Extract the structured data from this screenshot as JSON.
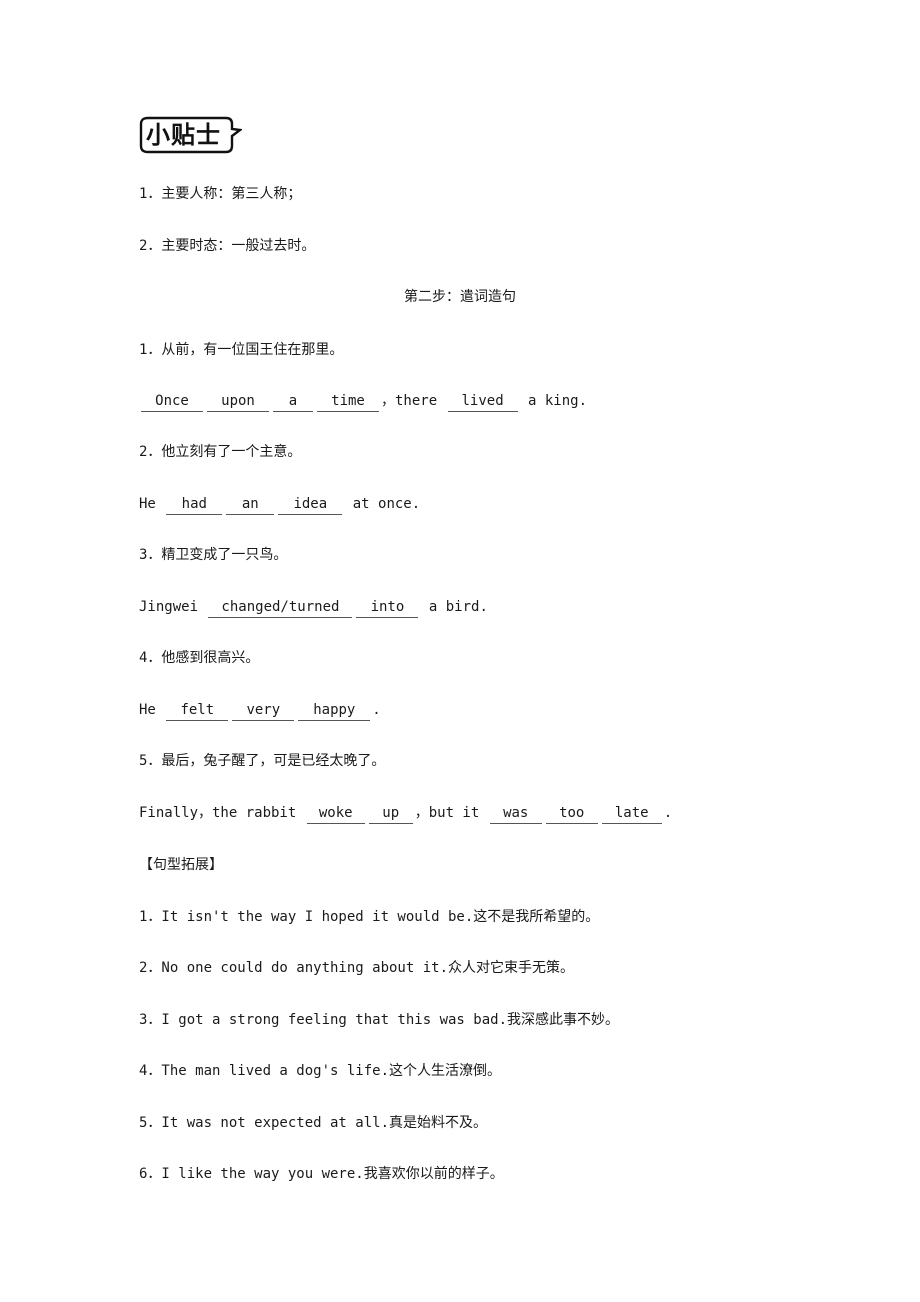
{
  "tip": {
    "label": "小贴士",
    "icon": "speech-bubble-icon"
  },
  "tips": [
    "1．主要人称：第三人称；",
    "2．主要时态：一般过去时。"
  ],
  "step_title": "第二步：遣词造句",
  "exercises": [
    {
      "prompt": "1．从前，有一位国王住在那里。",
      "parts": [
        {
          "type": "blank",
          "text": "Once",
          "w": 62
        },
        {
          "type": "blank",
          "text": "upon",
          "w": 62
        },
        {
          "type": "blank",
          "text": "a",
          "w": 40
        },
        {
          "type": "blank",
          "text": "time",
          "w": 62
        },
        {
          "type": "text",
          "text": "，there "
        },
        {
          "type": "blank",
          "text": "lived",
          "w": 70
        },
        {
          "type": "text",
          "text": " a king."
        }
      ]
    },
    {
      "prompt": "2．他立刻有了一个主意。",
      "parts": [
        {
          "type": "text",
          "text": "He "
        },
        {
          "type": "blank",
          "text": "had",
          "w": 56
        },
        {
          "type": "blank",
          "text": "an",
          "w": 48
        },
        {
          "type": "blank",
          "text": "idea",
          "w": 64
        },
        {
          "type": "text",
          "text": " at once."
        }
      ]
    },
    {
      "prompt": "3．精卫变成了一只鸟。",
      "parts": [
        {
          "type": "text",
          "text": "Jingwei "
        },
        {
          "type": "blank",
          "text": "changed/turned",
          "w": 144
        },
        {
          "type": "blank",
          "text": "into",
          "w": 62
        },
        {
          "type": "text",
          "text": " a bird."
        }
      ]
    },
    {
      "prompt": "4．他感到很高兴。",
      "parts": [
        {
          "type": "text",
          "text": "He "
        },
        {
          "type": "blank",
          "text": "felt",
          "w": 62
        },
        {
          "type": "blank",
          "text": "very",
          "w": 62
        },
        {
          "type": "blank",
          "text": "happy",
          "w": 72
        },
        {
          "type": "text",
          "text": "."
        }
      ]
    },
    {
      "prompt": "5．最后，兔子醒了，可是已经太晚了。",
      "parts": [
        {
          "type": "text",
          "text": "Finally，the rabbit "
        },
        {
          "type": "blank",
          "text": "woke",
          "w": 58
        },
        {
          "type": "blank",
          "text": "up",
          "w": 44
        },
        {
          "type": "text",
          "text": "，but it "
        },
        {
          "type": "blank",
          "text": "was",
          "w": 52
        },
        {
          "type": "blank",
          "text": "too",
          "w": 52
        },
        {
          "type": "blank",
          "text": "late",
          "w": 60
        },
        {
          "type": "text",
          "text": "."
        }
      ]
    }
  ],
  "extension_title": "【句型拓展】",
  "extensions": [
    "1．It isn't the way I hoped it would be.这不是我所希望的。",
    "2．No one could do anything about it.众人对它束手无策。",
    "3．I got a strong feeling that this was bad.我深感此事不妙。",
    "4．The man lived a dog's life.这个人生活潦倒。",
    "5．It was not expected at all.真是始料不及。",
    "6．I like the way you were.我喜欢你以前的样子。"
  ]
}
